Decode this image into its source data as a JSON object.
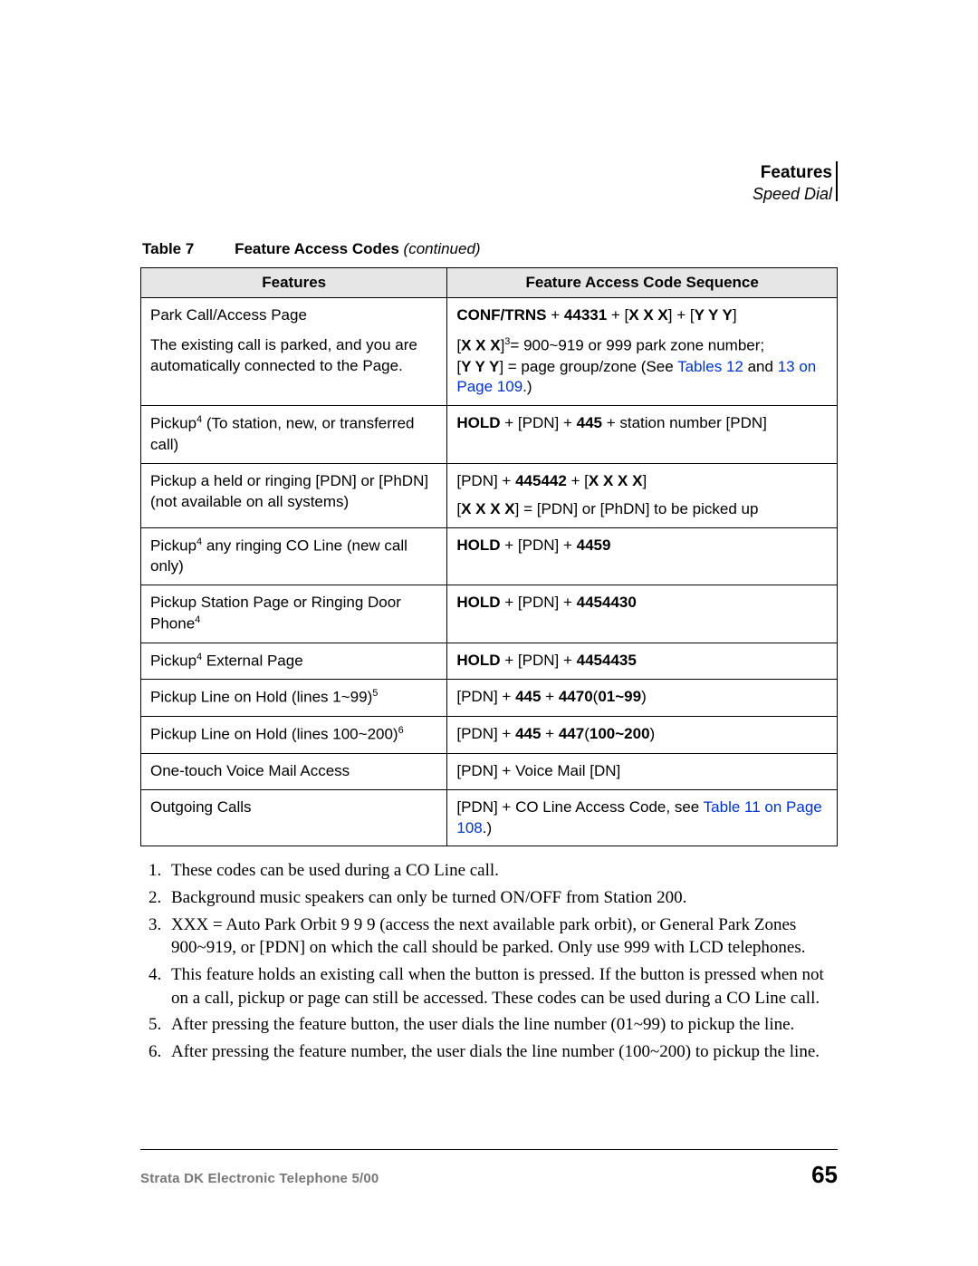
{
  "header": {
    "title": "Features",
    "subtitle": "Speed Dial"
  },
  "tableCaption": {
    "number": "Table 7",
    "title": "Feature Access Codes",
    "continued": "(continued)"
  },
  "columns": {
    "c1": "Features",
    "c2": "Feature Access Code Sequence"
  },
  "rows": {
    "r1": {
      "f_line1": "Park Call/Access Page",
      "f_line2": "The existing call is parked, and you are automatically connected to the Page.",
      "s_bold1": "CONF/TRNS",
      "s_plain1": " + ",
      "s_bold2": "44331",
      "s_plain2": " + [",
      "s_bold3": "X X X",
      "s_plain3": "] + [",
      "s_bold4": "Y Y Y",
      "s_plain4": "]",
      "s_line2a": "[",
      "s_line2b": "X X X",
      "s_line2sup": "3",
      "s_line2c": "= 900~919 or 999 park zone number;",
      "s_line3a": "[",
      "s_line3b": "Y Y Y",
      "s_line3c": "] = page group/zone (See ",
      "s_link1": "Tables 12",
      "s_line3d": " and ",
      "s_link2": "13 on Page 109",
      "s_line3e": ".)"
    },
    "r2": {
      "f_a": "Pickup",
      "f_sup": "4",
      "f_b": " (To station, new, or transferred call)",
      "s_b1": "HOLD",
      "s_p1": " + [PDN] + ",
      "s_b2": "445",
      "s_p2": " + station number [PDN]"
    },
    "r3": {
      "f_line1": "Pickup a held or ringing [PDN] or [PhDN] (not available on all systems)",
      "s_p1": "[PDN] + ",
      "s_b1": "445442",
      "s_p2": " + [",
      "s_b2": "X X X X",
      "s_p3": "]",
      "s_l2a": "[",
      "s_l2b": "X X X X",
      "s_l2c": "] = [PDN] or [PhDN] to be picked up"
    },
    "r4": {
      "f_a": "Pickup",
      "f_sup": "4",
      "f_b": " any ringing CO Line (new call only)",
      "s_b1": "HOLD",
      "s_p1": " + [PDN] + ",
      "s_b2": "4459"
    },
    "r5": {
      "f_a": "Pickup Station Page or Ringing Door Phone",
      "f_sup": "4",
      "s_b1": "HOLD",
      "s_p1": " + [PDN] +  ",
      "s_b2": "4454430"
    },
    "r6": {
      "f_a": "Pickup",
      "f_sup": "4",
      "f_b": " External Page",
      "s_b1": "HOLD",
      "s_p1": " + [PDN] + ",
      "s_b2": "4454435"
    },
    "r7": {
      "f_a": "Pickup Line on Hold (lines 1~99)",
      "f_sup": "5",
      "s_p1": "[PDN] + ",
      "s_b1": "445",
      "s_p2": " + ",
      "s_b2": "4470",
      "s_p3": "(",
      "s_b3": "01~99",
      "s_p4": ")"
    },
    "r8": {
      "f_a": "Pickup Line on Hold (lines 100~200)",
      "f_sup": "6",
      "s_p1": "[PDN] + ",
      "s_b1": "445",
      "s_p2": " + ",
      "s_b2": "447",
      "s_p3": "(",
      "s_b3": "100~200",
      "s_p4": ")"
    },
    "r9": {
      "f": "One-touch Voice Mail Access",
      "s": "[PDN] + Voice Mail [DN]"
    },
    "r10": {
      "f": "Outgoing Calls",
      "s_p1": "[PDN] + CO Line Access Code, see ",
      "s_link": "Table 11 on Page 108",
      "s_p2": ".)"
    }
  },
  "notes": {
    "n1": "These codes can be used during a CO Line call.",
    "n2": "Background music speakers can only be turned ON/OFF from Station 200.",
    "n3": "XXX = Auto Park Orbit 9 9 9 (access the next available park orbit), or General Park Zones 900~919, or [PDN] on which the call should be parked. Only use 999 with LCD telephones.",
    "n4": "This feature holds an existing call when the button is pressed. If the button is pressed when not on a call, pickup or page can still be accessed. These codes can be used during a CO Line call.",
    "n5": "After pressing the feature button, the user dials the line number (01~99) to pickup the line.",
    "n6": "After pressing the feature number, the user dials the line number (100~200) to pickup the line."
  },
  "footer": {
    "left": "Strata DK Electronic Telephone  5/00",
    "right": "65"
  }
}
